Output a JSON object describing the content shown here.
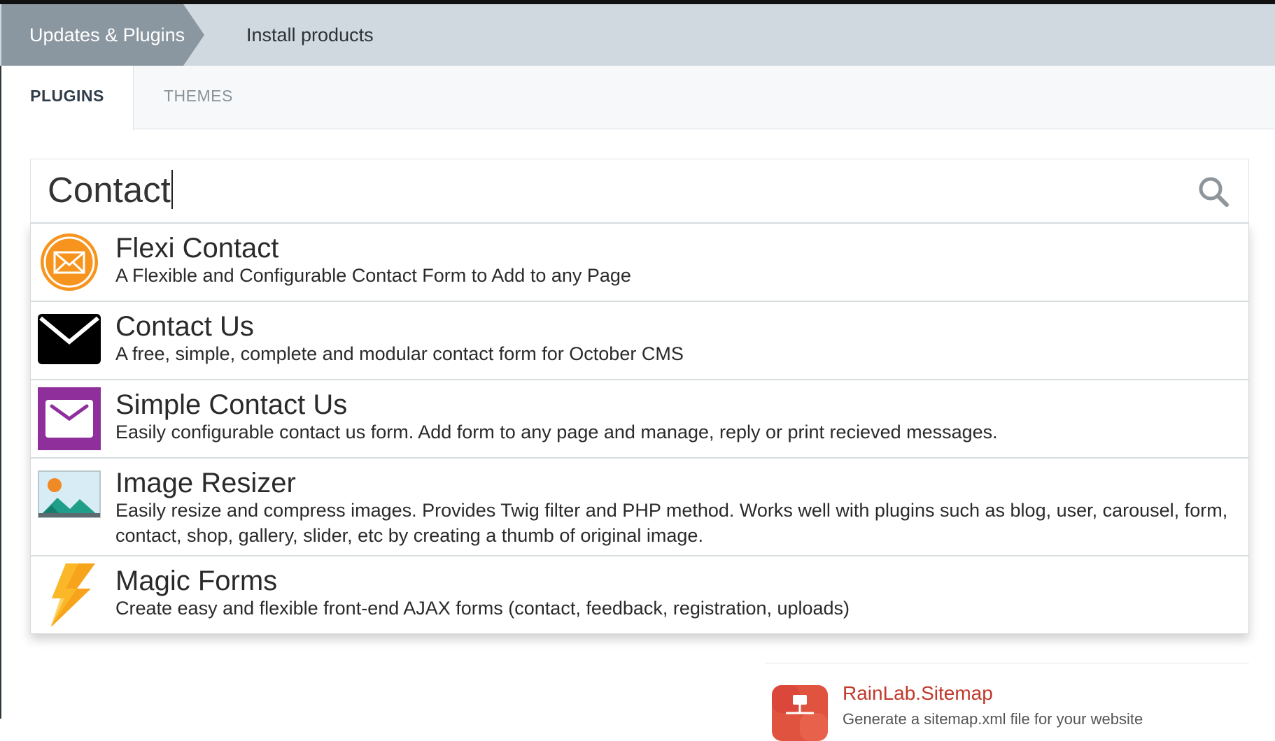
{
  "breadcrumb": {
    "active": "Updates & Plugins",
    "current": "Install products"
  },
  "tabs": [
    {
      "label": "Plugins",
      "selected": true
    },
    {
      "label": "Themes",
      "selected": false
    }
  ],
  "search": {
    "value": "Contact",
    "icon": "search-icon"
  },
  "results": [
    {
      "title": "Flexi Contact",
      "description": "A Flexible and Configurable Contact Form to Add to any Page",
      "icon": "envelope-circle-icon",
      "icon_color": "#f39c12"
    },
    {
      "title": "Contact Us",
      "description": "A free, simple, complete and modular contact form for October CMS",
      "icon": "envelope-icon",
      "icon_color": "#000000"
    },
    {
      "title": "Simple Contact Us",
      "description": "Easily configurable contact us form. Add form to any page and manage, reply or print recieved messages.",
      "icon": "envelope-square-icon",
      "icon_color": "#8e2f9b"
    },
    {
      "title": "Image Resizer",
      "description": "Easily resize and compress images. Provides Twig filter and PHP method. Works well with plugins such as blog, user, carousel, form, contact, shop, gallery, slider, etc by creating a thumb of original image.",
      "icon": "landscape-image-icon",
      "icon_color": "#2aa88f"
    },
    {
      "title": "Magic Forms",
      "description": "Create easy and flexible front-end AJAX forms (contact, feedback, registration, uploads)",
      "icon": "lightning-bolt-icon",
      "icon_color": "#f5a623"
    }
  ],
  "featured": {
    "title": "RainLab.Sitemap",
    "description": "Generate a sitemap.xml file for your website",
    "icon": "sitemap-icon",
    "title_color": "#c0392b"
  }
}
